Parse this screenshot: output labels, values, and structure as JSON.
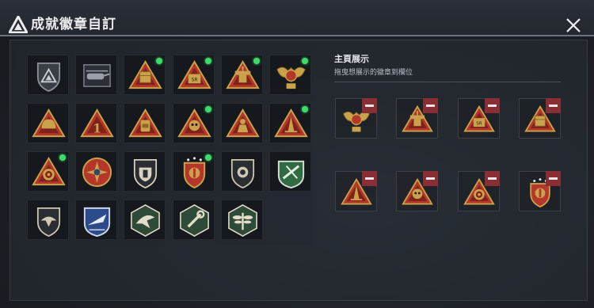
{
  "header": {
    "title": "成就徽章自訂",
    "logo_icon": "triangle-logo-icon",
    "close_icon": "close-icon"
  },
  "colors": {
    "accent_gold": "#c9a24a",
    "new_dot": "#3ddc68",
    "remove_button": "#8a2e35",
    "triangle_red": "#b5362b"
  },
  "badge_grid": {
    "rows": [
      [
        {
          "icon": "triangle-shield-badge-icon",
          "new": false
        },
        {
          "icon": "helicopter-badge-icon",
          "new": false
        },
        {
          "icon": "supply-crate-triangle-badge-icon",
          "new": true
        },
        {
          "icon": "sr-case-triangle-badge-icon",
          "new": true
        },
        {
          "icon": "turret-triangle-badge-icon",
          "new": true
        },
        {
          "icon": "winged-emblem-badge-icon",
          "new": true
        }
      ],
      [
        {
          "icon": "helmet-triangle-badge-icon",
          "new": false
        },
        {
          "icon": "number-one-triangle-badge-icon",
          "new": false
        },
        {
          "icon": "backpack-triangle-badge-icon",
          "new": false
        },
        {
          "icon": "skull-triangle-badge-icon",
          "new": true
        },
        {
          "icon": "soldier-triangle-badge-icon",
          "new": false
        },
        {
          "icon": "tower-triangle-badge-icon",
          "new": true
        }
      ],
      [
        {
          "icon": "gear-triangle-badge-icon",
          "new": true
        },
        {
          "icon": "star-cross-badge-icon",
          "new": false
        },
        {
          "icon": "shield-crest-badge-icon",
          "new": false
        },
        {
          "icon": "red-crest-badge-icon",
          "new": true
        },
        {
          "icon": "lion-shield-badge-icon",
          "new": false
        },
        {
          "icon": "green-rifle-badge-icon",
          "new": false
        }
      ],
      [
        {
          "icon": "hawk-shield-badge-icon",
          "new": false
        },
        {
          "icon": "jet-badge-icon",
          "new": false
        },
        {
          "icon": "eagle-hexagon-badge-icon",
          "new": false
        },
        {
          "icon": "wrench-hexagon-badge-icon",
          "new": false
        },
        {
          "icon": "dragonfly-hexagon-badge-icon",
          "new": false
        }
      ]
    ]
  },
  "showcase": {
    "title": "主頁展示",
    "subtitle": "拖曳想展示的徽章到欄位",
    "slots": [
      {
        "icon": "winged-emblem-badge-icon"
      },
      {
        "icon": "turret-triangle-badge-icon"
      },
      {
        "icon": "sr-case-triangle-badge-icon"
      },
      {
        "icon": "supply-crate-triangle-badge-icon"
      },
      {
        "icon": "tower-triangle-badge-icon"
      },
      {
        "icon": "skull-triangle-badge-icon"
      },
      {
        "icon": "gear-triangle-badge-icon"
      },
      {
        "icon": "red-crest-badge-icon"
      }
    ],
    "remove_icon": "minus-icon"
  }
}
